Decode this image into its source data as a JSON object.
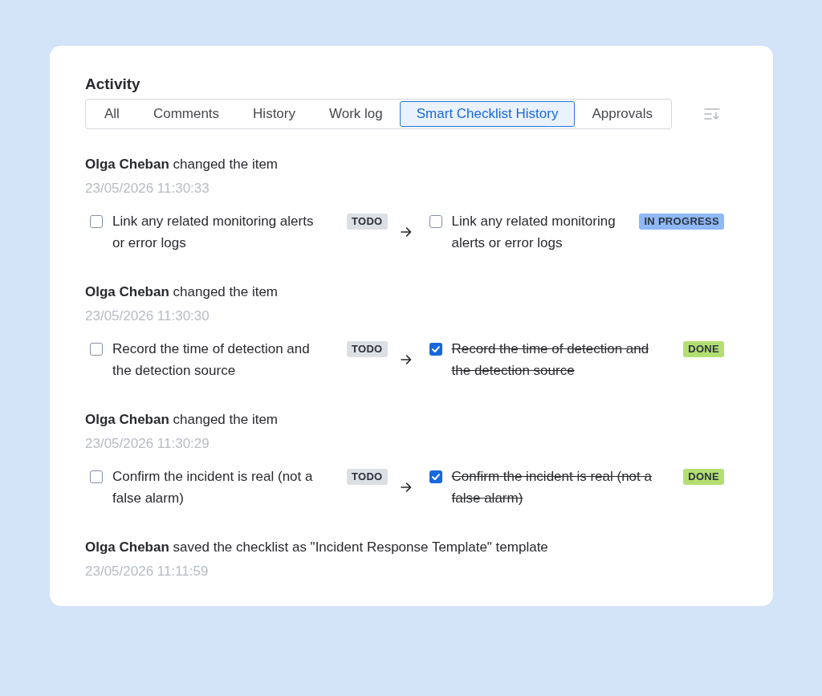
{
  "activity": {
    "title": "Activity"
  },
  "tabs": [
    {
      "label": "All",
      "selected": false
    },
    {
      "label": "Comments",
      "selected": false
    },
    {
      "label": "History",
      "selected": false
    },
    {
      "label": "Work log",
      "selected": false
    },
    {
      "label": "Smart Checklist History",
      "selected": true
    },
    {
      "label": "Approvals",
      "selected": false
    }
  ],
  "entries": [
    {
      "kind": "item_change",
      "text": "**Olga Cheban** changed the item",
      "date": "23/05/2026 11:30:33",
      "from": {
        "text": "Link any related monitoring alerts or error logs",
        "checked": false,
        "status": {
          "label": "TODO",
          "color": "#dcdfe4"
        }
      },
      "to": {
        "text": "Link any related monitoring alerts or error logs",
        "checked": false,
        "status": {
          "label": "IN PROGRESS",
          "color": "#8fb8f6"
        }
      }
    },
    {
      "kind": "item_change",
      "text": "**Olga Cheban** changed the item",
      "date": "23/05/2026 11:30:30",
      "from": {
        "text": "Record the time of detection and the detection source",
        "checked": false,
        "status": {
          "label": "TODO",
          "color": "#dcdfe4"
        }
      },
      "to": {
        "text": "Record the time of detection and the detection source",
        "checked": true,
        "status": {
          "label": "DONE",
          "color": "#b3df72"
        }
      }
    },
    {
      "kind": "item_change",
      "text": "**Olga Cheban** changed the item",
      "date": "23/05/2026 11:30:29",
      "from": {
        "text": "Confirm the incident is real (not a false alarm)",
        "checked": false,
        "status": {
          "label": "TODO",
          "color": "#dcdfe4"
        }
      },
      "to": {
        "text": "Confirm the incident is real (not a false alarm)",
        "checked": true,
        "status": {
          "label": "DONE",
          "color": "#b3df72"
        }
      }
    },
    {
      "kind": "template_saved",
      "text": "**Olga Cheban** saved the checklist as \"Incident Response Template\" template",
      "date": "23/05/2026 11:11:59"
    }
  ]
}
